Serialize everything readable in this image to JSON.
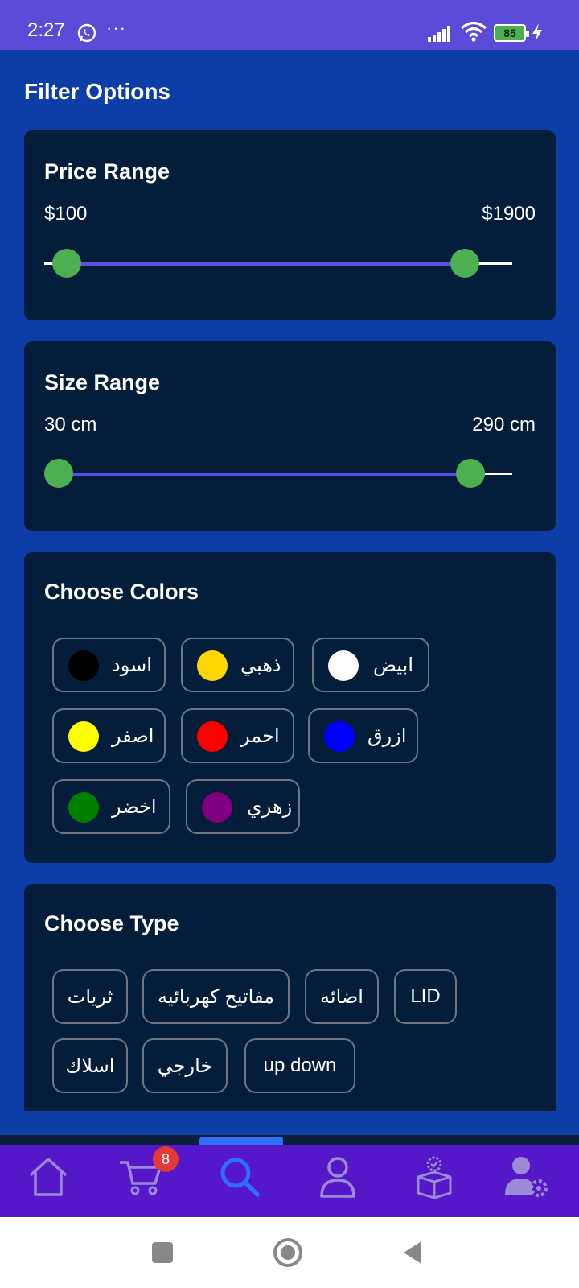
{
  "status_bar": {
    "time": "2:27",
    "dots": "···",
    "battery_level": "85",
    "icons": [
      "whatsapp-icon",
      "signal-icon",
      "wifi-icon",
      "battery-icon",
      "charging-icon"
    ]
  },
  "page_title": "Filter Options",
  "price_range": {
    "title": "Price Range",
    "min_label": "$100",
    "max_label": "$1900"
  },
  "size_range": {
    "title": "Size Range",
    "min_label": "30 cm",
    "max_label": "290 cm"
  },
  "colors": {
    "title": "Choose Colors",
    "items": [
      {
        "label": "اسود",
        "color": "#000000"
      },
      {
        "label": "ذهبي",
        "color": "#FFD700"
      },
      {
        "label": "ابيض",
        "color": "#FFFFFF"
      },
      {
        "label": "اصفر",
        "color": "#FFFF00"
      },
      {
        "label": "احمر",
        "color": "#FF0000"
      },
      {
        "label": "ازرق",
        "color": "#0000FF"
      },
      {
        "label": "اخضر",
        "color": "#008000"
      },
      {
        "label": "زهري",
        "color": "#800080"
      }
    ]
  },
  "types": {
    "title": "Choose Type",
    "items": [
      {
        "label": "ثريات"
      },
      {
        "label": "مفاتيح كهربائيه"
      },
      {
        "label": "اضائه"
      },
      {
        "label": "LID"
      },
      {
        "label": "اسلاك"
      },
      {
        "label": "خارجي"
      },
      {
        "label": "up down"
      }
    ]
  },
  "bottom_nav": {
    "cart_badge": "8",
    "active": "search",
    "items": [
      "home-icon",
      "cart-icon",
      "search-icon",
      "profile-icon",
      "orders-icon",
      "settings-user-icon"
    ],
    "active_color": "#2d6ff5",
    "inactive_color": "#9b8bd6"
  },
  "accent_colors": {
    "slider_thumb": "#4caf50",
    "slider_active": "#5b4fe0",
    "card_bg": "#041d3b",
    "page_bg": "#0d3da6"
  }
}
